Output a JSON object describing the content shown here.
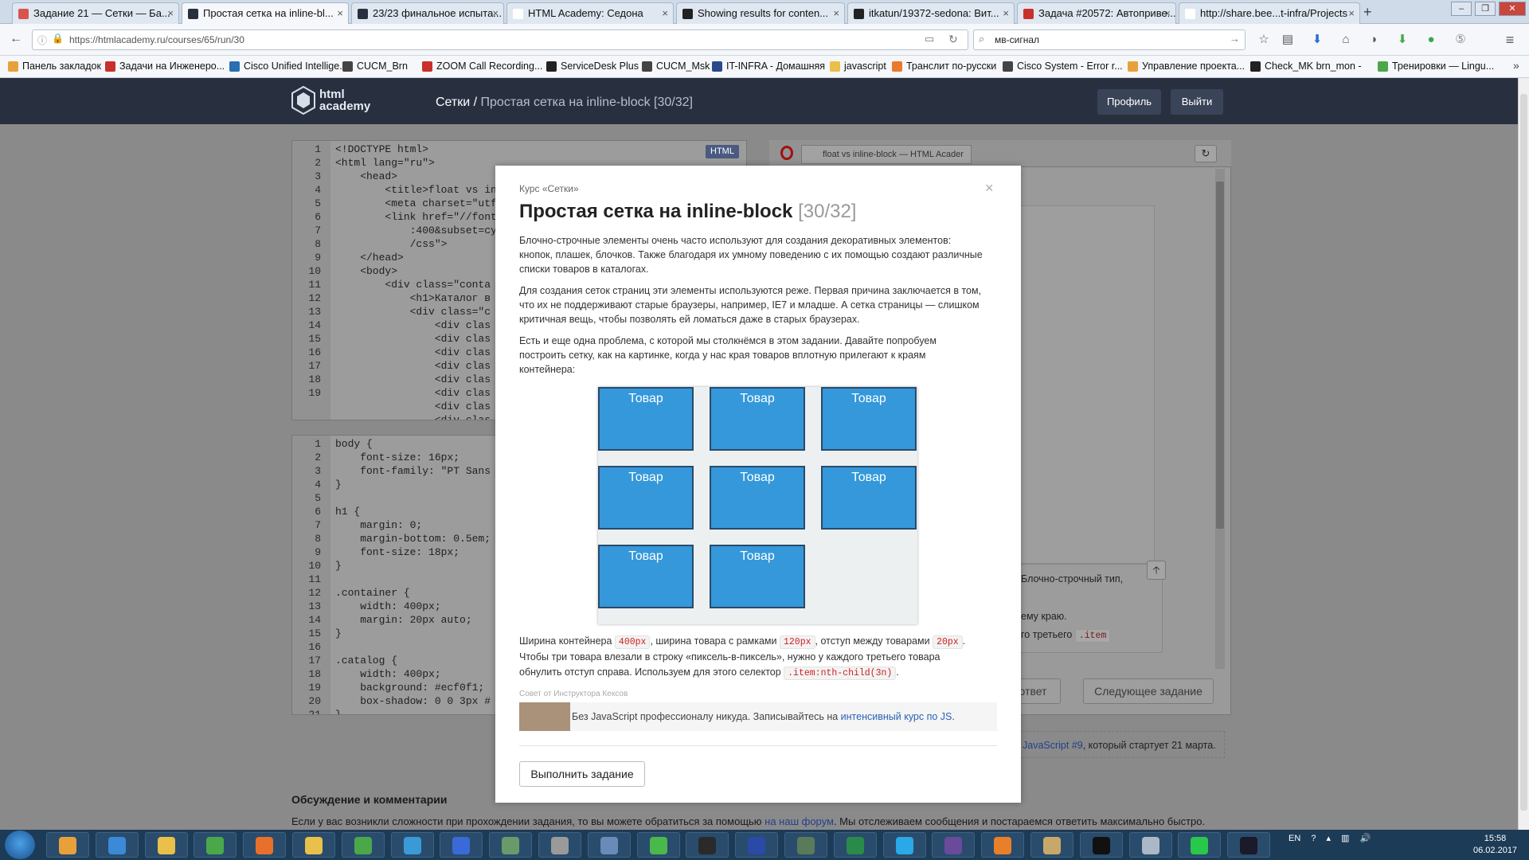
{
  "browser": {
    "tabs": [
      {
        "label": "Задание 21 — Сетки — Ба...",
        "favicon_color": "#d9534f"
      },
      {
        "label": "Простая сетка на inline-bl...",
        "favicon_color": "#283040"
      },
      {
        "label": "23/23 финальное испыта...",
        "favicon_color": "#283040"
      },
      {
        "label": "HTML Academy: Седона",
        "favicon_color": "#ffffff"
      },
      {
        "label": "Showing results for conten...",
        "favicon_color": "#222222"
      },
      {
        "label": "itkatun/19372-sedona: Вит...",
        "favicon_color": "#222222"
      },
      {
        "label": "Задача #20572: Автоприве...",
        "favicon_color": "#c9302c"
      },
      {
        "label": "http://share.bee...t-infra/Projects",
        "favicon_color": "#ffffff"
      }
    ],
    "new_tab": "+",
    "url": "https://htmlacademy.ru/courses/65/run/30",
    "search_value": "мв-сигнал",
    "bookmarks": [
      {
        "label": "Панель закладок",
        "color": "#e8a13a"
      },
      {
        "label": "Задачи на Инженеро...",
        "color": "#c9302c"
      },
      {
        "label": "Cisco Unified Intellige...",
        "color": "#2a6fb0"
      },
      {
        "label": "CUCM_Brn",
        "color": "#444444"
      },
      {
        "label": "ZOOM Call Recording...",
        "color": "#c9302c"
      },
      {
        "label": "ServiceDesk Plus",
        "color": "#222222"
      },
      {
        "label": "CUCM_Msk",
        "color": "#444444"
      },
      {
        "label": "IT-INFRA - Домашняя",
        "color": "#2a4a8a"
      },
      {
        "label": "javascript",
        "color": "#e8c04a"
      },
      {
        "label": "Транслит по-русски",
        "color": "#e87a2a"
      },
      {
        "label": "Cisco System - Error r...",
        "color": "#444444"
      },
      {
        "label": "Управление проекта...",
        "color": "#e8a13a"
      },
      {
        "label": "Check_MK brn_mon -",
        "color": "#222222"
      },
      {
        "label": "Тренировки — Lingu...",
        "color": "#4aa84a"
      }
    ]
  },
  "site": {
    "logo_text": "html academy",
    "breadcrumb_section": "Сетки",
    "breadcrumb_sep": " / ",
    "breadcrumb_current": "Простая сетка на inline-block [30/32]",
    "profile_button": "Профиль",
    "logout_button": "Выйти"
  },
  "editor_html": {
    "badge": "HTML",
    "line_numbers": [
      "1",
      "2",
      "3",
      "4",
      "5",
      "6",
      "",
      "",
      "7",
      "8",
      "9",
      "10",
      "11",
      "12",
      "13",
      "14",
      "15",
      "16",
      "17",
      "18",
      "19"
    ],
    "lines": [
      "<!DOCTYPE html>",
      "<html lang=\"ru\">",
      "    <head>",
      "        <title>float vs in",
      "        <meta charset=\"utf",
      "        <link href=\"//font",
      "            :400&subset=cy",
      "            /css\">",
      "    </head>",
      "    <body>",
      "        <div class=\"conta",
      "            <h1>Каталог в",
      "            <div class=\"c",
      "                <div clas",
      "                <div clas",
      "                <div clas",
      "                <div clas",
      "                <div clas",
      "                <div clas",
      "                <div clas",
      "                <div clas"
    ]
  },
  "editor_css": {
    "line_numbers": [
      "1",
      "2",
      "3",
      "4",
      "5",
      "6",
      "7",
      "8",
      "9",
      "10",
      "11",
      "12",
      "13",
      "14",
      "15",
      "16",
      "17",
      "18",
      "19",
      "20",
      "21"
    ],
    "lines": [
      "body {",
      "    font-size: 16px;",
      "    font-family: \"PT Sans",
      "}",
      "",
      "h1 {",
      "    margin: 0;",
      "    margin-bottom: 0.5em;",
      "    font-size: 18px;",
      "}",
      "",
      ".container {",
      "    width: 400px;",
      "    margin: 20px auto;",
      "}",
      "",
      ".catalog {",
      "    width: 400px;",
      "    background: #ecf0f1;",
      "    box-shadow: 0 0 3px #",
      "}"
    ]
  },
  "preview": {
    "tab_title": "float vs inline-block — HTML Acader",
    "text_1": "Блочно-строчный тип,",
    "text_2": "ему краю.",
    "text_3": "го третьего",
    "text_3_code": ".item",
    "answer_button": "ответ",
    "next_button": "Следующее задание",
    "promo_link": "JavaScript #9",
    "promo_text": ", который стартует 21 марта."
  },
  "modal": {
    "course": "Курс «Сетки»",
    "close": "×",
    "title": "Простая сетка на inline-block",
    "counter": "[30/32]",
    "para1": "Блочно-строчные элементы очень часто используют для создания декоративных элементов: кнопок, плашек, блочков. Также благодаря их умному поведению с их помощью создают различные списки товаров в каталогах.",
    "para2": "Для создания сеток страниц эти элементы используются реже. Первая причина заключается в том, что их не поддерживают старые браузеры, например, IE7 и младше. А сетка страницы — слишком критичная вещь, чтобы позволять ей ломаться даже в старых браузерах.",
    "para3": "Есть и еще одна проблема, с которой мы столкнёмся в этом задании. Давайте попробуем построить сетку, как на картинке, когда у нас края товаров вплотную прилегают к краям контейнера:",
    "items": [
      "Товар",
      "Товар",
      "Товар",
      "Товар",
      "Товар",
      "Товар",
      "Товар",
      "Товар"
    ],
    "bottom_a": "Ширина контейнера ",
    "code_1": "400px",
    "bottom_b": ", ширина товара с рамками ",
    "code_2": "120px",
    "bottom_c": ", отступ между товарами ",
    "code_3": "20px",
    "bottom_d": ". Чтобы три товара влезали в строку «пиксель-в-пиксель», нужно у каждого третьего товара обнулить отступ справа. Используем для этого селектор ",
    "code_4": ".item:nth-child(3n)",
    "bottom_e": ".",
    "tip_label": "Совет от Инструктора Кексов",
    "tip_text": "Без JavaScript профессионалу никуда. Записывайтесь на ",
    "tip_link": "интенсивный курс по JS",
    "tip_end": ".",
    "run_button": "Выполнить задание"
  },
  "page": {
    "discussion_title": "Обсуждение и комментарии",
    "help_text": "Если у вас возникли сложности при прохождении задания, то вы можете обратиться за помощью ",
    "help_link": "на наш форум",
    "help_end": ". Мы отслеживаем сообщения и постараемся ответить максимально быстро."
  },
  "taskbar": {
    "language": "EN",
    "time": "15:58",
    "date": "06.02.2017",
    "apps": [
      {
        "name": "outlook",
        "color": "#e8a13a"
      },
      {
        "name": "internet-explorer",
        "color": "#3a8ad8"
      },
      {
        "name": "explorer",
        "color": "#e8c04a"
      },
      {
        "name": "task-manager",
        "color": "#4aa84a"
      },
      {
        "name": "firefox",
        "color": "#e8702a"
      },
      {
        "name": "headset",
        "color": "#e8c04a"
      },
      {
        "name": "chrome",
        "color": "#4aa84a"
      },
      {
        "name": "phone",
        "color": "#3a9ad8"
      },
      {
        "name": "network",
        "color": "#3a6ad8"
      },
      {
        "name": "turtle",
        "color": "#6a9a6a"
      },
      {
        "name": "database",
        "color": "#9a9a9a"
      },
      {
        "name": "vmware",
        "color": "#6a8ab8"
      },
      {
        "name": "numbers",
        "color": "#4ab84a"
      },
      {
        "name": "hs",
        "color": "#2a2a2a"
      },
      {
        "name": "save",
        "color": "#2a4aa8"
      },
      {
        "name": "terminal-server",
        "color": "#5a7a5a"
      },
      {
        "name": "excel",
        "color": "#2a8a4a"
      },
      {
        "name": "skype",
        "color": "#2aa8e8"
      },
      {
        "name": "cat-app",
        "color": "#6a4a9a"
      },
      {
        "name": "sublime",
        "color": "#e8802a"
      },
      {
        "name": "tools",
        "color": "#c8a86a"
      },
      {
        "name": "cmd",
        "color": "#111111"
      },
      {
        "name": "calculator",
        "color": "#aab8c8"
      },
      {
        "name": "green-s",
        "color": "#2ac84a"
      },
      {
        "name": "r-app",
        "color": "#1a1a2a"
      }
    ]
  }
}
